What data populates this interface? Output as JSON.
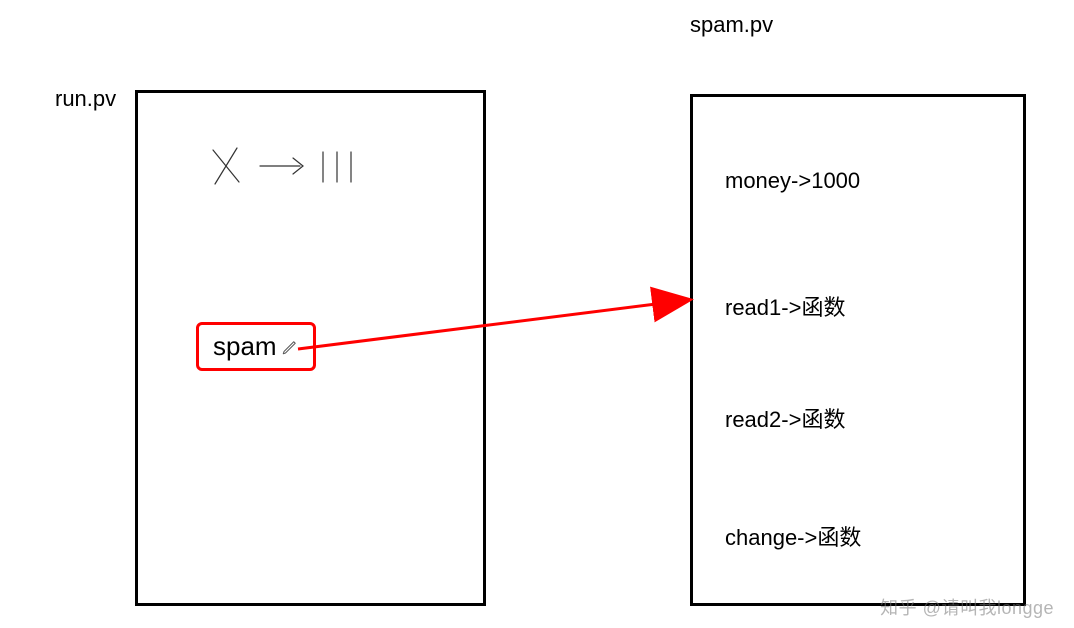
{
  "left": {
    "title": "run.pv",
    "spam_label": "spam"
  },
  "right": {
    "title": "spam.pv",
    "entries": {
      "money": "money->1000",
      "read1": "read1->函数",
      "read2": "read2->函数",
      "change": "change->函数"
    }
  },
  "watermark": "知乎 @请叫我longge"
}
